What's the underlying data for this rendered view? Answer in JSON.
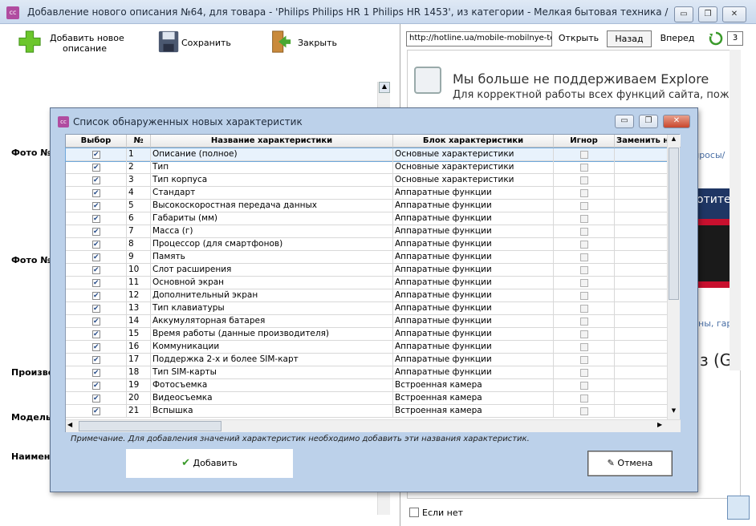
{
  "window": {
    "title": "Добавление нового описания №64, для товара - 'Philips Philips HR 1 Philips HR 1453', из категории - Мелкая бытовая техника / Миксеры / Philips",
    "icon": "app-logo-icon",
    "minimize": "▭",
    "restore": "❐",
    "close": "✕"
  },
  "toolbar": {
    "add_label_1": "Добавить новое",
    "add_label_2": "описание",
    "save_label": "Сохранить",
    "close_label": "Закрыть"
  },
  "form": {
    "photo1": "Фото №",
    "photo2": "Фото №",
    "producer": "Произво",
    "model": "Модель",
    "name": "Наимено"
  },
  "browser": {
    "url": "http://hotline.ua/mobile-mobilnye-tel",
    "open": "Открыть",
    "back": "Назад",
    "forward": "Вперед",
    "refresh_icon": "refresh-icon",
    "counter": "3",
    "heading": "Мы больше не поддерживаем Explore",
    "subheading": "Для корректной работы всех функций сайта, пож",
    "frag1": "просы/",
    "frag2": "отите",
    "frag3": "ны, гар",
    "frag4": "з (G",
    "checkbox_label": "Если нет"
  },
  "dialog": {
    "title": "Список обнаруженных новых характеристик",
    "columns": [
      "Выбор",
      "№",
      "Название характеристики",
      "Блок характеристики",
      "Игнор",
      "Заменить н"
    ],
    "rows": [
      {
        "n": "1",
        "name": "Описание (полное)",
        "block": "Основные характеристики"
      },
      {
        "n": "2",
        "name": "Тип",
        "block": "Основные характеристики"
      },
      {
        "n": "3",
        "name": "Тип корпуса",
        "block": "Основные характеристики"
      },
      {
        "n": "4",
        "name": "Стандарт",
        "block": "Аппаратные функции"
      },
      {
        "n": "5",
        "name": "Высокоскоростная передача данных",
        "block": "Аппаратные функции"
      },
      {
        "n": "6",
        "name": "Габариты (мм)",
        "block": "Аппаратные функции"
      },
      {
        "n": "7",
        "name": "Масса (г)",
        "block": "Аппаратные функции"
      },
      {
        "n": "8",
        "name": "Процессор (для смартфонов)",
        "block": "Аппаратные функции"
      },
      {
        "n": "9",
        "name": "Память",
        "block": "Аппаратные функции"
      },
      {
        "n": "10",
        "name": "Слот расширения",
        "block": "Аппаратные функции"
      },
      {
        "n": "11",
        "name": "Основной экран",
        "block": "Аппаратные функции"
      },
      {
        "n": "12",
        "name": "Дополнительный экран",
        "block": "Аппаратные функции"
      },
      {
        "n": "13",
        "name": "Тип клавиатуры",
        "block": "Аппаратные функции"
      },
      {
        "n": "14",
        "name": "Аккумуляторная батарея",
        "block": "Аппаратные функции"
      },
      {
        "n": "15",
        "name": "Время работы (данные производителя)",
        "block": "Аппаратные функции"
      },
      {
        "n": "16",
        "name": "Коммуникации",
        "block": "Аппаратные функции"
      },
      {
        "n": "17",
        "name": "Поддержка 2-х и более SIM-карт",
        "block": "Аппаратные функции"
      },
      {
        "n": "18",
        "name": "Тип SIM-карты",
        "block": "Аппаратные функции"
      },
      {
        "n": "19",
        "name": "Фотосъемка",
        "block": "Встроенная камера"
      },
      {
        "n": "20",
        "name": "Видеосъемка",
        "block": "Встроенная камера"
      },
      {
        "n": "21",
        "name": "Вспышка",
        "block": "Встроенная камера"
      }
    ],
    "note": "Примечание. Для добавления значений характеристик необходимо добавить эти названия характеристик.",
    "add_button": "Добавить",
    "cancel_button": "Отмена"
  },
  "colors": {
    "accent": "#2a4f8a",
    "dialog_bg": "#bcd1ea",
    "selection": "#e8f2fc"
  }
}
